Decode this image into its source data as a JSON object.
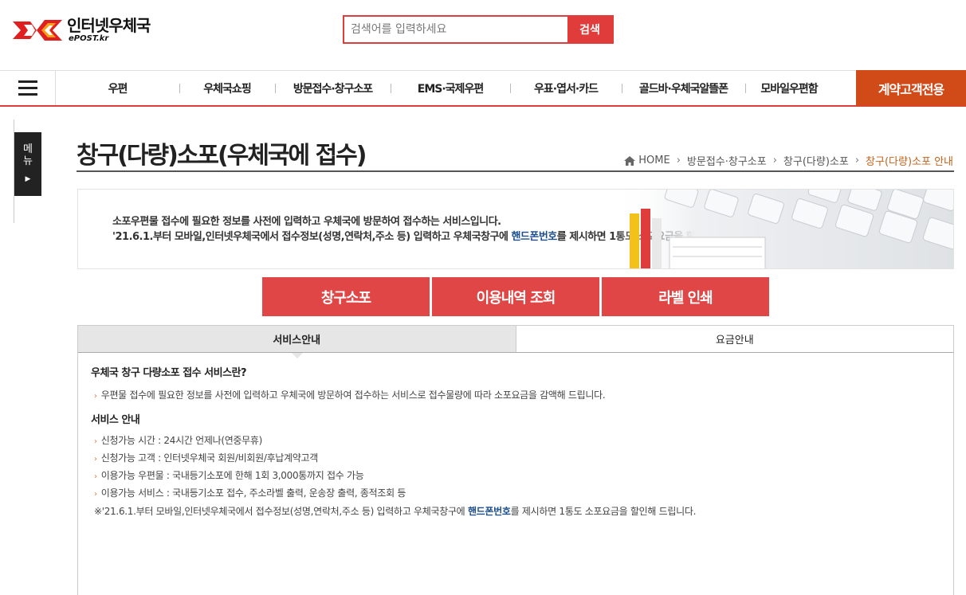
{
  "header": {
    "logo_title": "인터넷우체국",
    "logo_sub": "ePOST.kr",
    "search_placeholder": "검색어를 입력하세요",
    "search_button": "검색"
  },
  "gnb": {
    "items": [
      {
        "label": "우편"
      },
      {
        "label": "우체국쇼핑"
      },
      {
        "label": "방문접수·창구소포"
      },
      {
        "label": "EMS·국제우편"
      },
      {
        "label": "우표·엽서·카드"
      },
      {
        "label": "골드바·우체국알뜰폰"
      },
      {
        "label": "모바일우편함"
      }
    ],
    "special": "계약고객전용"
  },
  "side_menu": {
    "line1": "메",
    "line2": "뉴",
    "arrow": "▶"
  },
  "page": {
    "title": "창구(다량)소포(우체국에 접수)",
    "breadcrumb": [
      "HOME",
      "방문접수·창구소포",
      "창구(다량)소포",
      "창구(다량)소포 안내"
    ]
  },
  "banner": {
    "line1": "소포우편물 접수에 필요한 정보를 사전에 입력하고 우체국에 방문하여 접수하는 서비스입니다.",
    "line2_pre": "'21.6.1.부터 모바일,인터넷우체국에서 접수정보(성명,연락처,주소 등) 입력하고 우체국창구에 ",
    "line2_hl": "핸드폰번호",
    "line2_post": "를 제시하면 1통도 소포요금을 할인해 드립니다."
  },
  "actions": [
    "창구소포",
    "이용내역 조회",
    "라벨 인쇄"
  ],
  "tabs": [
    "서비스안내",
    "요금안내"
  ],
  "content": {
    "section1_title": "우체국 창구 다량소포 접수 서비스란?",
    "section1_bullet": "우편물 접수에 필요한 정보를 사전에 입력하고 우체국에 방문하여 접수하는 서비스로 접수물량에 따라 소포요금을 감액해 드립니다.",
    "section2_title": "서비스 안내",
    "bullets": [
      "신청가능 시간 : 24시간 언제나(연중무휴)",
      "신청가능 고객 : 인터넷우체국 회원/비회원/후납계약고객",
      "이용가능 우편물 : 국내등기소포에 한해 1회 3,000통까지 접수 가능",
      "이용가능 서비스 : 국내등기소포 접수, 주소라벨 출력, 운송장 출력, 종적조회 등"
    ],
    "note_pre": "※'21.6.1.부터 모바일,인터넷우체국에서 접수정보(성명,연락처,주소 등) 입력하고 우체국창구에 ",
    "note_hl": "핸드폰번호",
    "note_post": "를 제시하면 1통도 소포요금을 할인해 드립니다."
  },
  "colors": {
    "accent": "#e03c3c",
    "special": "#d14b19",
    "link": "#1c4f8f",
    "bullet": "#e0783c"
  }
}
